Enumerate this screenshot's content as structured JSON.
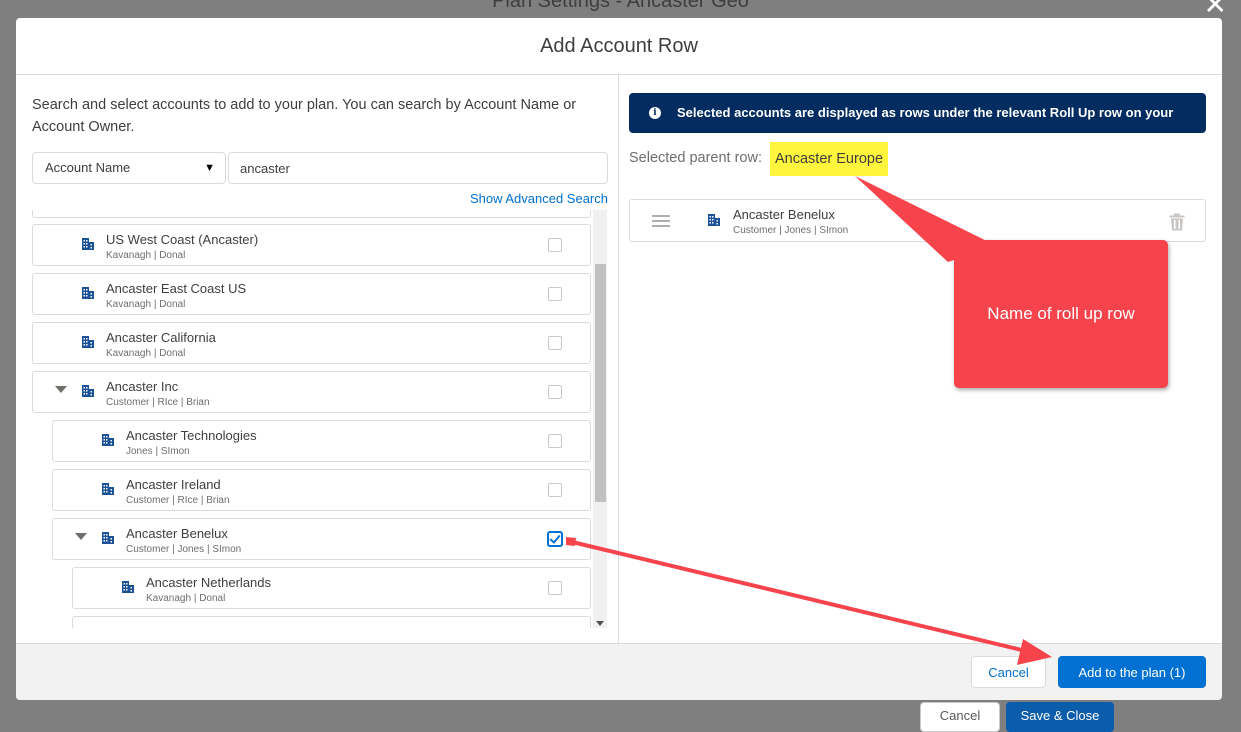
{
  "background": {
    "title": "Plan Settings - Ancaster Geo",
    "cancel_label": "Cancel",
    "save_label": "Save & Close"
  },
  "modal": {
    "title": "Add Account Row",
    "intro": "Search and select accounts to add to your plan. You can search by Account Name or Account Owner.",
    "search_field": {
      "selected": "Account Name",
      "value": "ancaster"
    },
    "advanced_search_label": "Show Advanced Search",
    "accounts": [
      {
        "name": "US West Coast (Ancaster)",
        "sub": "Kavanagh | Donal",
        "checked": false
      },
      {
        "name": "Ancaster East Coast US",
        "sub": "Kavanagh | Donal",
        "checked": false
      },
      {
        "name": "Ancaster California",
        "sub": "Kavanagh | Donal",
        "checked": false
      },
      {
        "name": "Ancaster Inc",
        "sub": "Customer | RIce | Brian",
        "checked": false,
        "expanded": true
      },
      {
        "name": "Ancaster Technologies",
        "sub": "Jones | SImon",
        "checked": false
      },
      {
        "name": "Ancaster Ireland",
        "sub": "Customer | RIce | Brian",
        "checked": false
      },
      {
        "name": "Ancaster Benelux",
        "sub": "Customer | Jones | SImon",
        "checked": true,
        "expanded": true
      },
      {
        "name": "Ancaster Netherlands",
        "sub": "Kavanagh | Donal",
        "checked": false
      }
    ],
    "info_banner": "Selected accounts are displayed as rows under the relevant Roll Up row on your",
    "parent_label": "Selected parent row:",
    "parent_value": "Ancaster Europe",
    "selected_rows": [
      {
        "name": "Ancaster Benelux",
        "sub": "Customer | Jones | SImon"
      }
    ],
    "cancel_label": "Cancel",
    "add_label": "Add to the plan (1)"
  },
  "annotation": {
    "callout_text": "Name of roll up row",
    "color": "#f7444c"
  },
  "colors": {
    "brand": "#0070d2",
    "banner": "#032d60",
    "highlight": "#fff53d",
    "icon": "#1b5297"
  }
}
